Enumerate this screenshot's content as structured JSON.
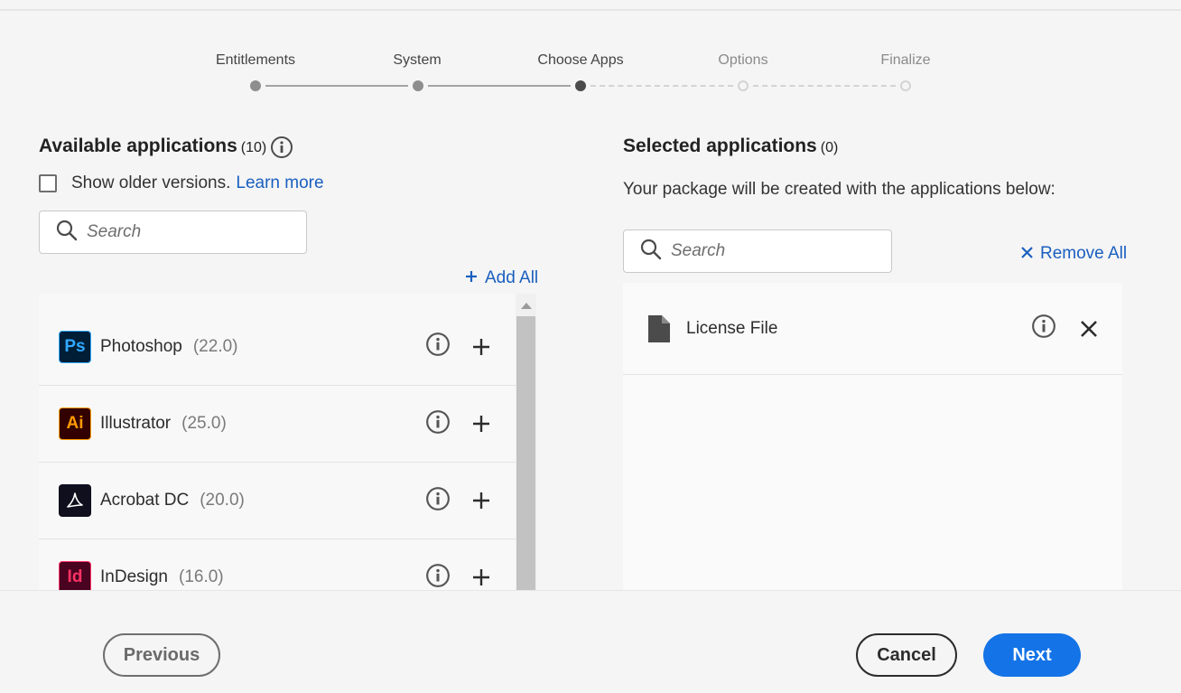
{
  "stepper": {
    "steps": [
      {
        "label": "Entitlements",
        "state": "done"
      },
      {
        "label": "System",
        "state": "done"
      },
      {
        "label": "Choose Apps",
        "state": "current"
      },
      {
        "label": "Options",
        "state": "future"
      },
      {
        "label": "Finalize",
        "state": "future"
      }
    ]
  },
  "available": {
    "title": "Available applications",
    "count": "(10)",
    "show_older_label": "Show older versions.",
    "learn_more": "Learn more",
    "search_placeholder": "Search",
    "add_all": "Add All",
    "apps": [
      {
        "name": "Photoshop",
        "version": "(22.0)",
        "logo": "Ps",
        "logo_bg": "#001e36",
        "logo_fg": "#31a8ff"
      },
      {
        "name": "Illustrator",
        "version": "(25.0)",
        "logo": "Ai",
        "logo_bg": "#330000",
        "logo_fg": "#ff9a00"
      },
      {
        "name": "Acrobat DC",
        "version": "(20.0)",
        "logo": "acrobat-icon",
        "logo_bg": "#0f0f1e",
        "logo_fg": "#ffffff"
      },
      {
        "name": "InDesign",
        "version": "(16.0)",
        "logo": "Id",
        "logo_bg": "#49021f",
        "logo_fg": "#ff3366"
      }
    ]
  },
  "selected": {
    "title": "Selected applications",
    "count": "(0)",
    "description": "Your package will be created with the applications below:",
    "search_placeholder": "Search",
    "remove_all": "Remove All",
    "items": [
      {
        "name": "License File",
        "icon": "file-icon"
      }
    ]
  },
  "footer": {
    "previous": "Previous",
    "cancel": "Cancel",
    "next": "Next"
  },
  "colors": {
    "accent": "#1473e6",
    "link": "#1a5fbf"
  }
}
